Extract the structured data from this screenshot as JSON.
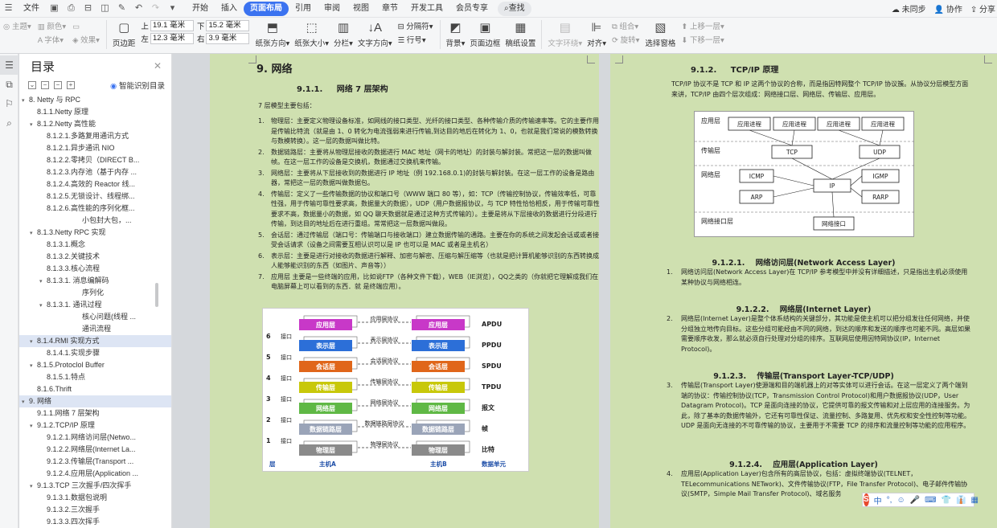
{
  "menubar": {
    "file": "文件",
    "tabs": [
      "开始",
      "插入",
      "页面布局",
      "引用",
      "审阅",
      "视图",
      "章节",
      "开发工具",
      "会员专享"
    ],
    "active_tab": "页面布局",
    "search": "查找",
    "right": [
      "未同步",
      "协作",
      "分享"
    ]
  },
  "ribbon": {
    "theme_group": [
      "主题",
      "颜色",
      "字体",
      "效果"
    ],
    "page_margin": "页边距",
    "margins": {
      "top_label": "上",
      "top": "19.1 毫米",
      "bottom_label": "下",
      "bottom": "15.2 毫米",
      "left_label": "左",
      "left": "12.3 毫米",
      "right_label": "右",
      "right": "3.9 毫米"
    },
    "buttons": [
      "纸张方向",
      "纸张大小",
      "分栏",
      "文字方向",
      "分隔符",
      "行号",
      "背景",
      "页面边框",
      "稿纸设置",
      "文字环绕",
      "对齐",
      "组合",
      "旋转",
      "选择窗格",
      "上移一层",
      "下移一层"
    ]
  },
  "toc": {
    "title": "目录",
    "smart_label": "智能识别目录",
    "items": [
      {
        "text": "8. Netty 与 RPC",
        "level": 0,
        "arrow": "▾"
      },
      {
        "text": "8.1.1.Netty 原理",
        "level": 1,
        "arrow": ""
      },
      {
        "text": "8.1.2.Netty 高性能",
        "level": 1,
        "arrow": "▾"
      },
      {
        "text": "8.1.2.1.多路复用通讯方式",
        "level": 2,
        "arrow": ""
      },
      {
        "text": "8.1.2.1.异步通讯 NIO",
        "level": 2,
        "arrow": ""
      },
      {
        "text": "8.1.2.2.零拷贝（DIRECT B...",
        "level": 2,
        "arrow": ""
      },
      {
        "text": "8.1.2.3.内存池（基于内存 ...",
        "level": 2,
        "arrow": ""
      },
      {
        "text": "8.1.2.4.高效的 Reactor 线...",
        "level": 2,
        "arrow": ""
      },
      {
        "text": "8.1.2.5.无锁设计、线程绑...",
        "level": 2,
        "arrow": ""
      },
      {
        "text": "8.1.2.6.高性能的序列化框...",
        "level": 2,
        "arrow": ""
      },
      {
        "text": "小包封大包，...",
        "level": 4,
        "arrow": ""
      },
      {
        "text": "8.1.3.Netty RPC 实现",
        "level": 1,
        "arrow": "▾"
      },
      {
        "text": "8.1.3.1.概念",
        "level": 2,
        "arrow": ""
      },
      {
        "text": "8.1.3.2.关键技术",
        "level": 2,
        "arrow": ""
      },
      {
        "text": "8.1.3.3.核心流程",
        "level": 2,
        "arrow": ""
      },
      {
        "text": "8.1.3.1. 消息编解码",
        "level": 2,
        "arrow": "▾"
      },
      {
        "text": "序列化",
        "level": 4,
        "arrow": ""
      },
      {
        "text": "8.1.3.1. 通讯过程",
        "level": 2,
        "arrow": "▾"
      },
      {
        "text": "核心问题(线程 ...",
        "level": 4,
        "arrow": ""
      },
      {
        "text": "通讯流程",
        "level": 4,
        "arrow": ""
      },
      {
        "text": "8.1.4.RMI 实现方式",
        "level": 1,
        "arrow": "▾",
        "selected": true
      },
      {
        "text": "8.1.4.1.实现步骤",
        "level": 2,
        "arrow": ""
      },
      {
        "text": "8.1.5.Protoclol Buffer",
        "level": 1,
        "arrow": "▾"
      },
      {
        "text": "8.1.5.1.特点",
        "level": 2,
        "arrow": ""
      },
      {
        "text": "8.1.6.Thrift",
        "level": 1,
        "arrow": ""
      },
      {
        "text": "9. 网络",
        "level": 0,
        "arrow": "▾",
        "selected": true
      },
      {
        "text": "9.1.1.网络 7 层架构",
        "level": 1,
        "arrow": ""
      },
      {
        "text": "9.1.2.TCP/IP 原理",
        "level": 1,
        "arrow": "▾"
      },
      {
        "text": "9.1.2.1.网络访问层(Netwo...",
        "level": 2,
        "arrow": ""
      },
      {
        "text": "9.1.2.2.网络层(Internet La...",
        "level": 2,
        "arrow": ""
      },
      {
        "text": "9.1.2.3.传输层(Transport ...",
        "level": 2,
        "arrow": ""
      },
      {
        "text": "9.1.2.4.应用层(Application ...",
        "level": 2,
        "arrow": ""
      },
      {
        "text": "9.1.3.TCP 三次握手/四次挥手",
        "level": 1,
        "arrow": "▾"
      },
      {
        "text": "9.1.3.1.数据包说明",
        "level": 2,
        "arrow": ""
      },
      {
        "text": "9.1.3.2.三次握手",
        "level": 2,
        "arrow": ""
      },
      {
        "text": "9.1.3.3.四次挥手",
        "level": 2,
        "arrow": ""
      }
    ]
  },
  "page1": {
    "h1": "9. 网络",
    "h2_num": "9.1.1.",
    "h2": "网络 7 层架构",
    "intro": "7 层模型主要包括：",
    "items": [
      {
        "n": "1.",
        "t": "物理层：主要定义物理设备标准，如网线的接口类型、光纤的接口类型、各种传输介质的传输速率等。它的主要作用是传输比特流（就是由 1、0 转化为电流强弱来进行传输,到达目的地后在转化为 1、0，也就是我们常说的模数转换与数模转换）。这一层的数据叫做比特。"
      },
      {
        "n": "2.",
        "t": "数据链路层：主要将从物理层接收的数据进行 MAC 地址（网卡的地址）的封装与解封装。常把这一层的数据叫做帧。在这一层工作的设备是交换机，数据通过交换机来传输。"
      },
      {
        "n": "3.",
        "t": "网络层：主要将从下层接收到的数据进行 IP 地址（例 192.168.0.1)的封装与解封装。在这一层工作的设备是路由器，常把这一层的数据叫做数据包。"
      },
      {
        "n": "4.",
        "t": "传输层：定义了一些传输数据的协议和端口号（WWW 端口 80 等），如：TCP（传输控制协议，传输效率低，可靠性强，用于传输可靠性要求高，数据量大的数据），UDP（用户数据报协议，与 TCP 特性恰恰相反，用于传输可靠性要求不高，数据量小的数据，如 QQ 聊天数据就是通过这种方式传输的）。主要是将从下层接收的数据进行分段进行传输，到达目的地址后在进行重组。常常把这一层数据叫做段。"
      },
      {
        "n": "5.",
        "t": "会话层：通过传输层（端口号：传输端口与接收端口）建立数据传输的通路。主要在你的系统之间发起会话或或者接受会话请求（设备之间需要互相认识可以是 IP 也可以是 MAC 或者是主机名）"
      },
      {
        "n": "6.",
        "t": "表示层：主要是进行对接收的数据进行解释、加密与解密、压缩与解压缩等（也就是把计算机能够识别的东西转换成人能够能识别的东西（如图片、声音等））"
      },
      {
        "n": "7.",
        "t": "应用层 主要是一些终端的应用，比如说FTP（各种文件下载），WEB（IE浏览），QQ之类的（你就把它理解成我们在电脑屏幕上可以看到的东西．就 是终端应用）。"
      }
    ],
    "figure": {
      "layers": [
        "应用层",
        "表示层",
        "会话层",
        "传输层",
        "网络层",
        "数据链路层",
        "物理层"
      ],
      "protocols": [
        "应用层协议",
        "表示层协议",
        "会话层协议",
        "传输层协议",
        "网络层协议",
        "数据链路层协议",
        "物理层协议"
      ],
      "units": [
        "APDU",
        "PPDU",
        "SPDU",
        "TPDU",
        "报文",
        "帧",
        "比特"
      ],
      "nums": [
        "6",
        "5",
        "4",
        "3",
        "2",
        "1"
      ],
      "iface": "接口",
      "footer": [
        "层",
        "主机A",
        "主机B",
        "数据单元"
      ],
      "colors": [
        "#c838c8",
        "#2c6fd8",
        "#e0661a",
        "#c8c80a",
        "#5fb845",
        "#9aa4b8",
        "#8a8a8a"
      ]
    }
  },
  "page2": {
    "h2_num": "9.1.2.",
    "h2": "TCP/IP 原理",
    "intro": "TCP/IP 协议不是 TCP 和 IP 这两个协议的合称，而是指因特网整个 TCP/IP 协议簇。从协议分层模型方面来讲，TCP/IP 由四个层次组成：网络接口层、网络层、传输层、应用层。",
    "tcp_fig": {
      "layers": [
        "应用层",
        "传输层",
        "网络层",
        "网络接口层"
      ],
      "app": [
        "应用进程",
        "应用进程",
        "应用进程",
        "应用进程"
      ],
      "transport": [
        "TCP",
        "UDP"
      ],
      "net": [
        "ICMP",
        "IP",
        "IGMP",
        "ARP",
        "RARP"
      ],
      "iface": "网络接口"
    },
    "sections": [
      {
        "num": "9.1.2.1.",
        "title": "网络访问层(Network Access Layer)",
        "n": "1.",
        "text": "网络访问层(Network Access Layer)在 TCP/IP 参考模型中并没有详细描述，只是指出主机必须使用某种协议与网络相连。"
      },
      {
        "num": "9.1.2.2.",
        "title": "网络层(Internet Layer)",
        "n": "2.",
        "text": "网络层(Internet Layer)是整个体系结构的关键部分，其功能是使主机可以把分组发往任何网络，并使分组独立地传向目标。这些分组可能经由不同的网络，到达的顺序和发送的顺序也可能不同。高层如果需要顺序收发，那么就必须自行处理对分组的排序。互联网层使用因特网协议(IP，Internet Protocol)。"
      },
      {
        "num": "9.1.2.3.",
        "title": "传输层(Transport Layer-TCP/UDP)",
        "n": "3.",
        "text": "传输层(Transport Layer)使源端和目的端机器上的对等实体可以进行会话。在这一层定义了两个端到端的协议：传输控制协议(TCP，Transmission Control Protocol)和用户数据报协议(UDP，User Datagram Protocol)。TCP 是面向连接的协议，它提供可靠的报文传输和对上层应用的连接服务。为此，除了基本的数据传输外，它还有可靠性保证、流量控制、多路复用、优先权和安全性控制等功能。UDP 是面向无连接的不可靠传输的协议，主要用于不需要 TCP 的排序和流量控制等功能的应用程序。"
      },
      {
        "num": "9.1.2.4.",
        "title": "应用层(Application Layer)",
        "n": "4.",
        "text": "应用层(Application Layer)包含所有的高层协议，包括：虚拟终端协议(TELNET，TELecommunications NETwork)、文件传输协议(FTP，File Transfer Protocol)、电子邮件传输协议(SMTP，Simple Mail Transfer Protocol)、域名服务"
      }
    ]
  },
  "ime": {
    "items": [
      "中",
      "°,",
      "☺",
      "🎤",
      "⌨",
      "👕",
      "👔",
      "▦"
    ]
  }
}
